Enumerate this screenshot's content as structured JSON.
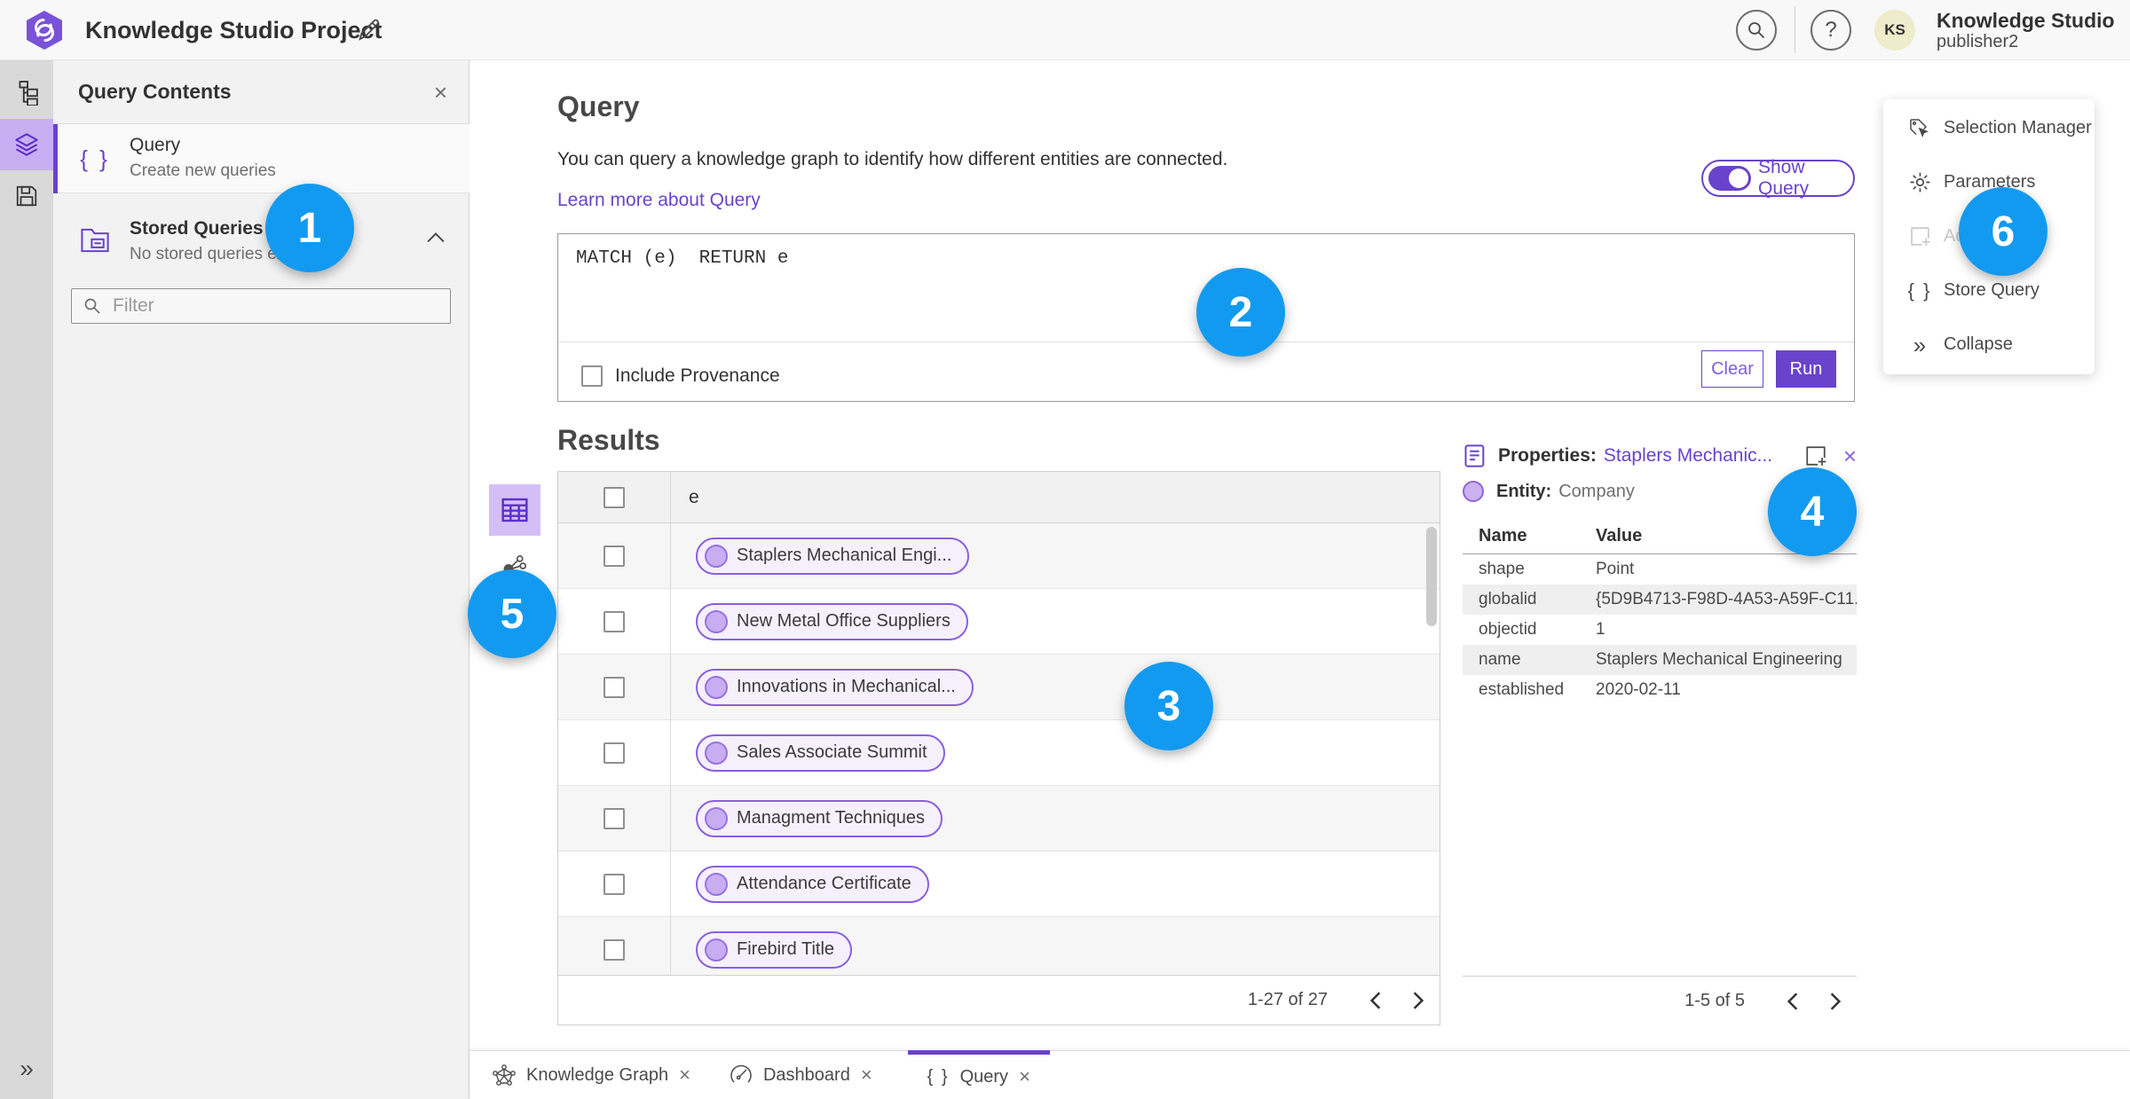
{
  "topbar": {
    "title": "Knowledge Studio Project",
    "user_name": "Knowledge Studio",
    "user_role": "publisher2",
    "avatar_initials": "KS",
    "help_glyph": "?"
  },
  "panel": {
    "title": "Query Contents",
    "close_glyph": "×",
    "query_item": {
      "title": "Query",
      "subtitle": "Create new queries"
    },
    "stored_item": {
      "title": "Stored Queries",
      "subtitle": "No stored queries exist"
    },
    "filter_placeholder": "Filter"
  },
  "query": {
    "heading": "Query",
    "description": "You can query a knowledge graph to identify how different entities are connected.",
    "learn_more": "Learn more about Query",
    "show_query_label": "Show Query",
    "editor_text": "MATCH (e)  RETURN e",
    "include_provenance_label": "Include Provenance",
    "clear_label": "Clear",
    "run_label": "Run"
  },
  "results": {
    "heading": "Results",
    "column_header": "e",
    "rows": [
      "Staplers Mechanical Engi...",
      "New Metal Office Suppliers",
      "Innovations in Mechanical...",
      "Sales Associate Summit",
      "Managment Techniques",
      "Attendance Certificate",
      "Firebird Title"
    ],
    "pagination": "1-27 of 27"
  },
  "properties": {
    "title_prefix": "Properties:",
    "title_link": "Staplers Mechanic...",
    "close_glyph": "×",
    "entity_label": "Entity:",
    "entity_value": "Company",
    "col_name": "Name",
    "col_value": "Value",
    "rows": [
      {
        "name": "shape",
        "value": "Point"
      },
      {
        "name": "globalid",
        "value": "{5D9B4713-F98D-4A53-A59F-C11..."
      },
      {
        "name": "objectid",
        "value": "1"
      },
      {
        "name": "name",
        "value": "Staplers Mechanical Engineering"
      },
      {
        "name": "established",
        "value": "2020-02-11"
      }
    ],
    "pagination": "1-5 of 5"
  },
  "menu": {
    "items": [
      "Selection Manager",
      "Parameters",
      "Add",
      "Store Query",
      "Collapse"
    ],
    "braces_glyph": "{ }",
    "collapse_glyph": "»"
  },
  "tabs": [
    {
      "label": "Knowledge Graph",
      "close_glyph": "×"
    },
    {
      "label": "Dashboard",
      "close_glyph": "×"
    },
    {
      "label": "Query",
      "close_glyph": "×"
    }
  ],
  "rail": {
    "expand_glyph": "»"
  },
  "glyphs": {
    "braces": "{ }"
  },
  "annotations": [
    "1",
    "2",
    "3",
    "4",
    "5",
    "6"
  ],
  "colors": {
    "accent": "#6943cb",
    "selection_purple": "#c8aff3",
    "annotation_blue": "#129af0"
  }
}
